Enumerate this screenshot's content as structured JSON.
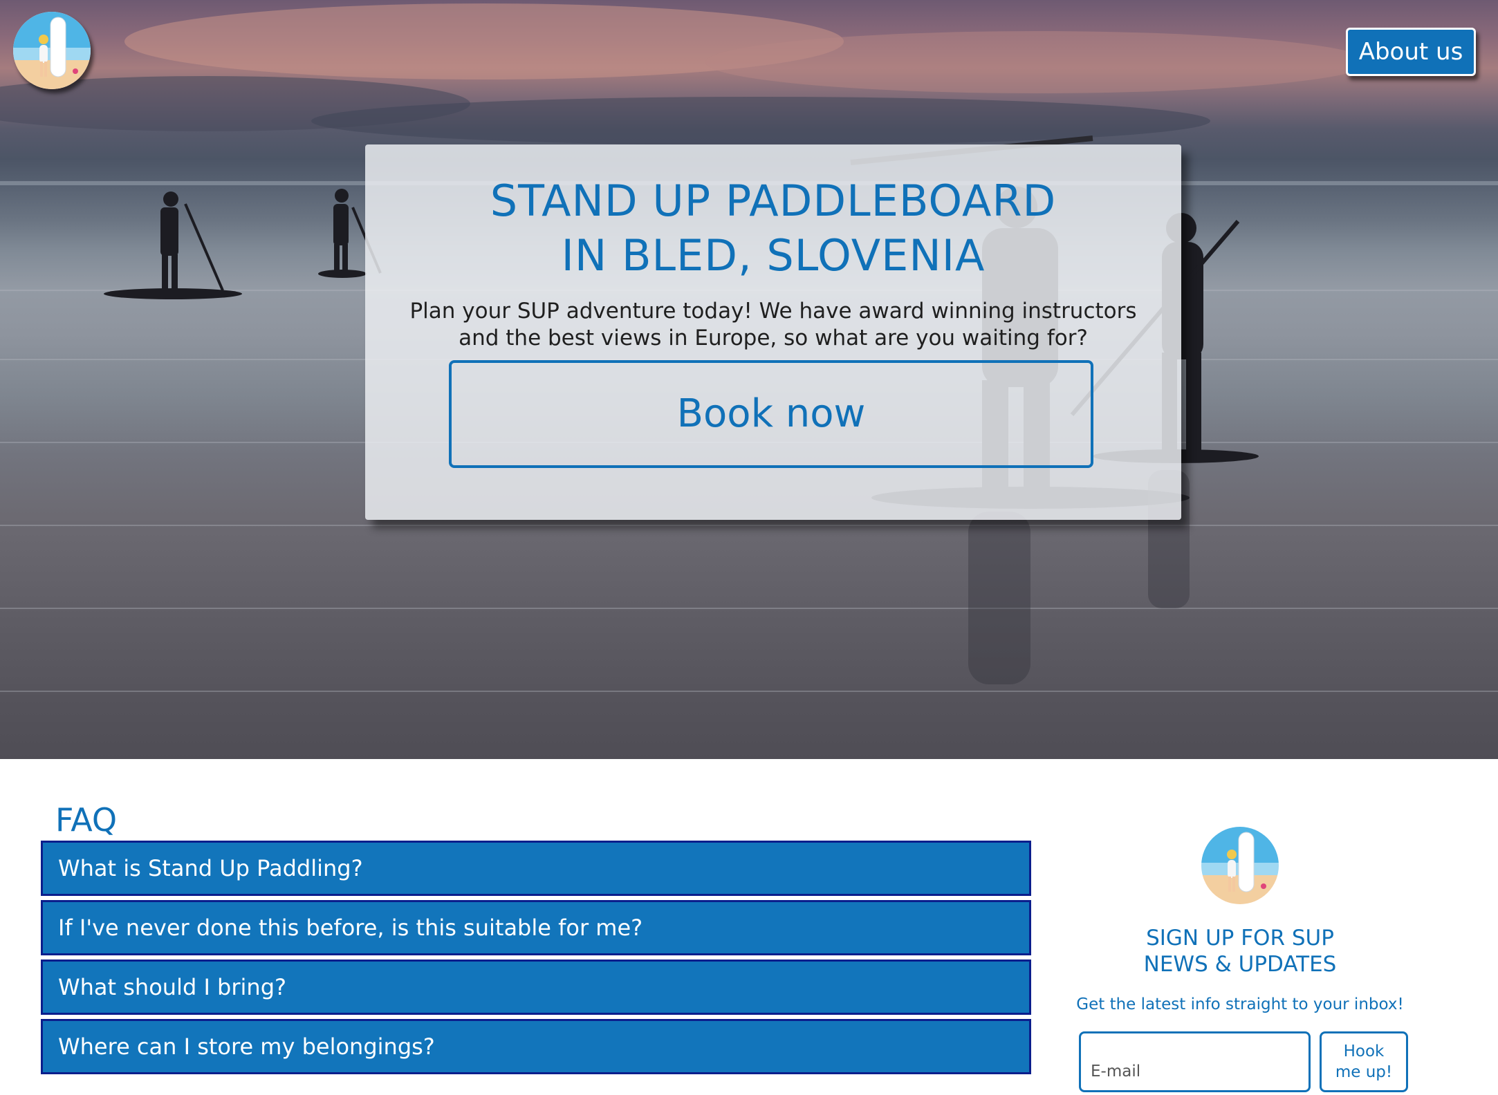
{
  "header": {
    "about_label": "About us"
  },
  "hero": {
    "title_line1": "STAND UP PADDLEBOARD",
    "title_line2": "IN BLED, SLOVENIA",
    "subtitle_line1": "Plan your SUP adventure today! We have award winning instructors",
    "subtitle_line2": "and the best views in Europe, so what are you waiting for?",
    "book_label": "Book now"
  },
  "faq": {
    "title": "FAQ",
    "items": [
      {
        "question": "What is Stand Up Paddling?"
      },
      {
        "question": "If I've never done this before, is this suitable for me?"
      },
      {
        "question": "What should I bring?"
      },
      {
        "question": "Where can I store my belongings?"
      }
    ]
  },
  "signup": {
    "title_line1": "SIGN UP FOR SUP",
    "title_line2": "NEWS & UPDATES",
    "subtitle": "Get the latest info straight to your inbox!",
    "email_placeholder": "E-mail",
    "button_line1": "Hook",
    "button_line2": "me up!"
  },
  "colors": {
    "brand_blue": "#1071b8",
    "faq_item_bg": "#1275bb",
    "faq_item_border": "#0b1e8c"
  },
  "icons": [
    "surfer-logo-icon",
    "paddleboarder-silhouette"
  ]
}
